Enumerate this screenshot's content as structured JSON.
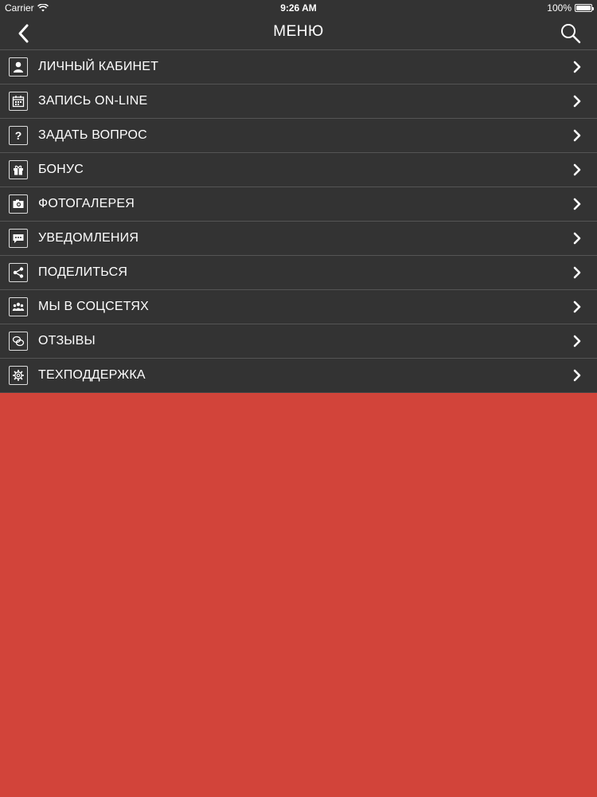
{
  "status_bar": {
    "carrier": "Carrier",
    "time": "9:26 AM",
    "battery": "100%",
    "battery_level": 1.0
  },
  "nav": {
    "title": "МЕНЮ",
    "back_icon": "chevron-left-icon",
    "search_icon": "search-icon"
  },
  "colors": {
    "header_bg": "#333333",
    "body_bg": "#d2443a",
    "divider": "#555555",
    "text": "#ffffff"
  },
  "menu": {
    "items": [
      {
        "label": "ЛИЧНЫЙ КАБИНЕТ",
        "icon": "user-icon"
      },
      {
        "label": "ЗАПИСЬ ON-LINE",
        "icon": "calendar-icon"
      },
      {
        "label": "ЗАДАТЬ ВОПРОС",
        "icon": "question-icon"
      },
      {
        "label": "БОНУС",
        "icon": "gift-icon"
      },
      {
        "label": "ФОТОГАЛЕРЕЯ",
        "icon": "camera-icon"
      },
      {
        "label": "УВЕДОМЛЕНИЯ",
        "icon": "message-icon"
      },
      {
        "label": "ПОДЕЛИТЬСЯ",
        "icon": "share-icon"
      },
      {
        "label": "МЫ В СОЦСЕТЯХ",
        "icon": "people-icon"
      },
      {
        "label": "ОТЗЫВЫ",
        "icon": "chat-bubbles-icon"
      },
      {
        "label": "ТЕХПОДДЕРЖКА",
        "icon": "gear-icon"
      }
    ]
  }
}
